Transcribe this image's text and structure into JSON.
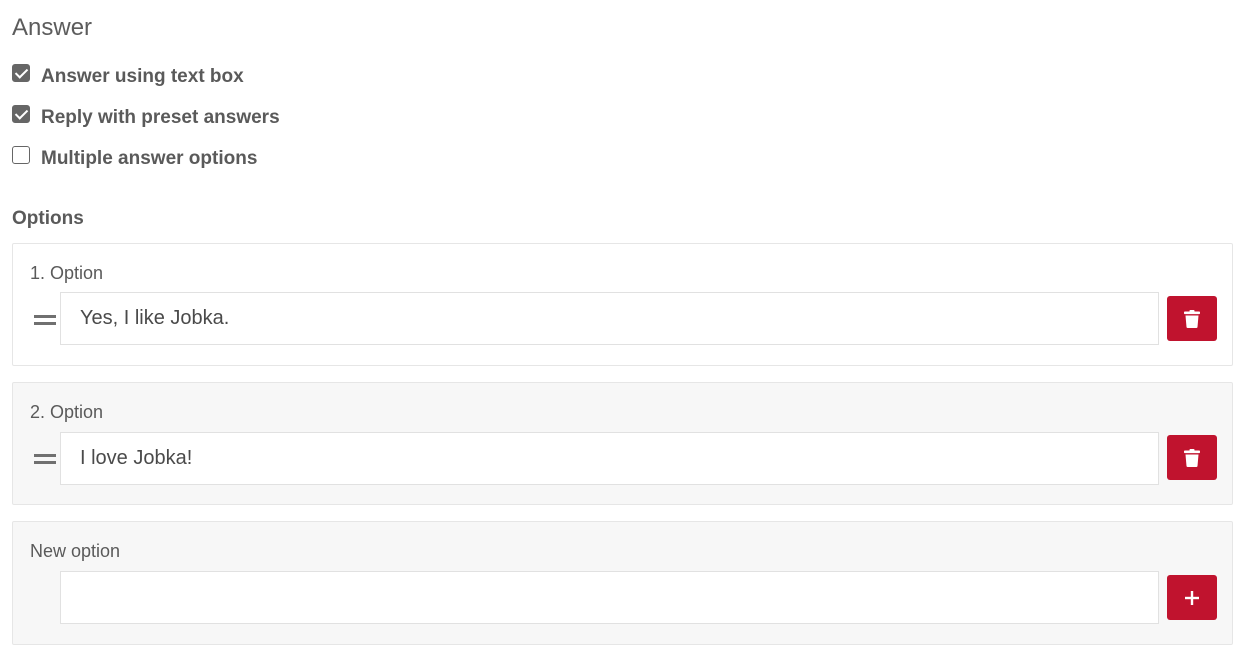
{
  "answer": {
    "title": "Answer",
    "checkboxes": [
      {
        "label": "Answer using text box",
        "checked": true
      },
      {
        "label": "Reply with preset answers",
        "checked": true
      },
      {
        "label": "Multiple answer options",
        "checked": false
      }
    ]
  },
  "options": {
    "label": "Options",
    "items": [
      {
        "label": "1. Option",
        "value": "Yes, I like Jobka.",
        "delete_icon": "trash-icon"
      },
      {
        "label": "2. Option",
        "value": "I love Jobka!",
        "delete_icon": "trash-icon"
      }
    ],
    "new_option": {
      "label": "New option",
      "value": "",
      "add_icon": "plus-icon"
    }
  },
  "colors": {
    "accent": "#c0132e",
    "text": "#5a5a5a",
    "card_grey": "#f7f7f7"
  }
}
